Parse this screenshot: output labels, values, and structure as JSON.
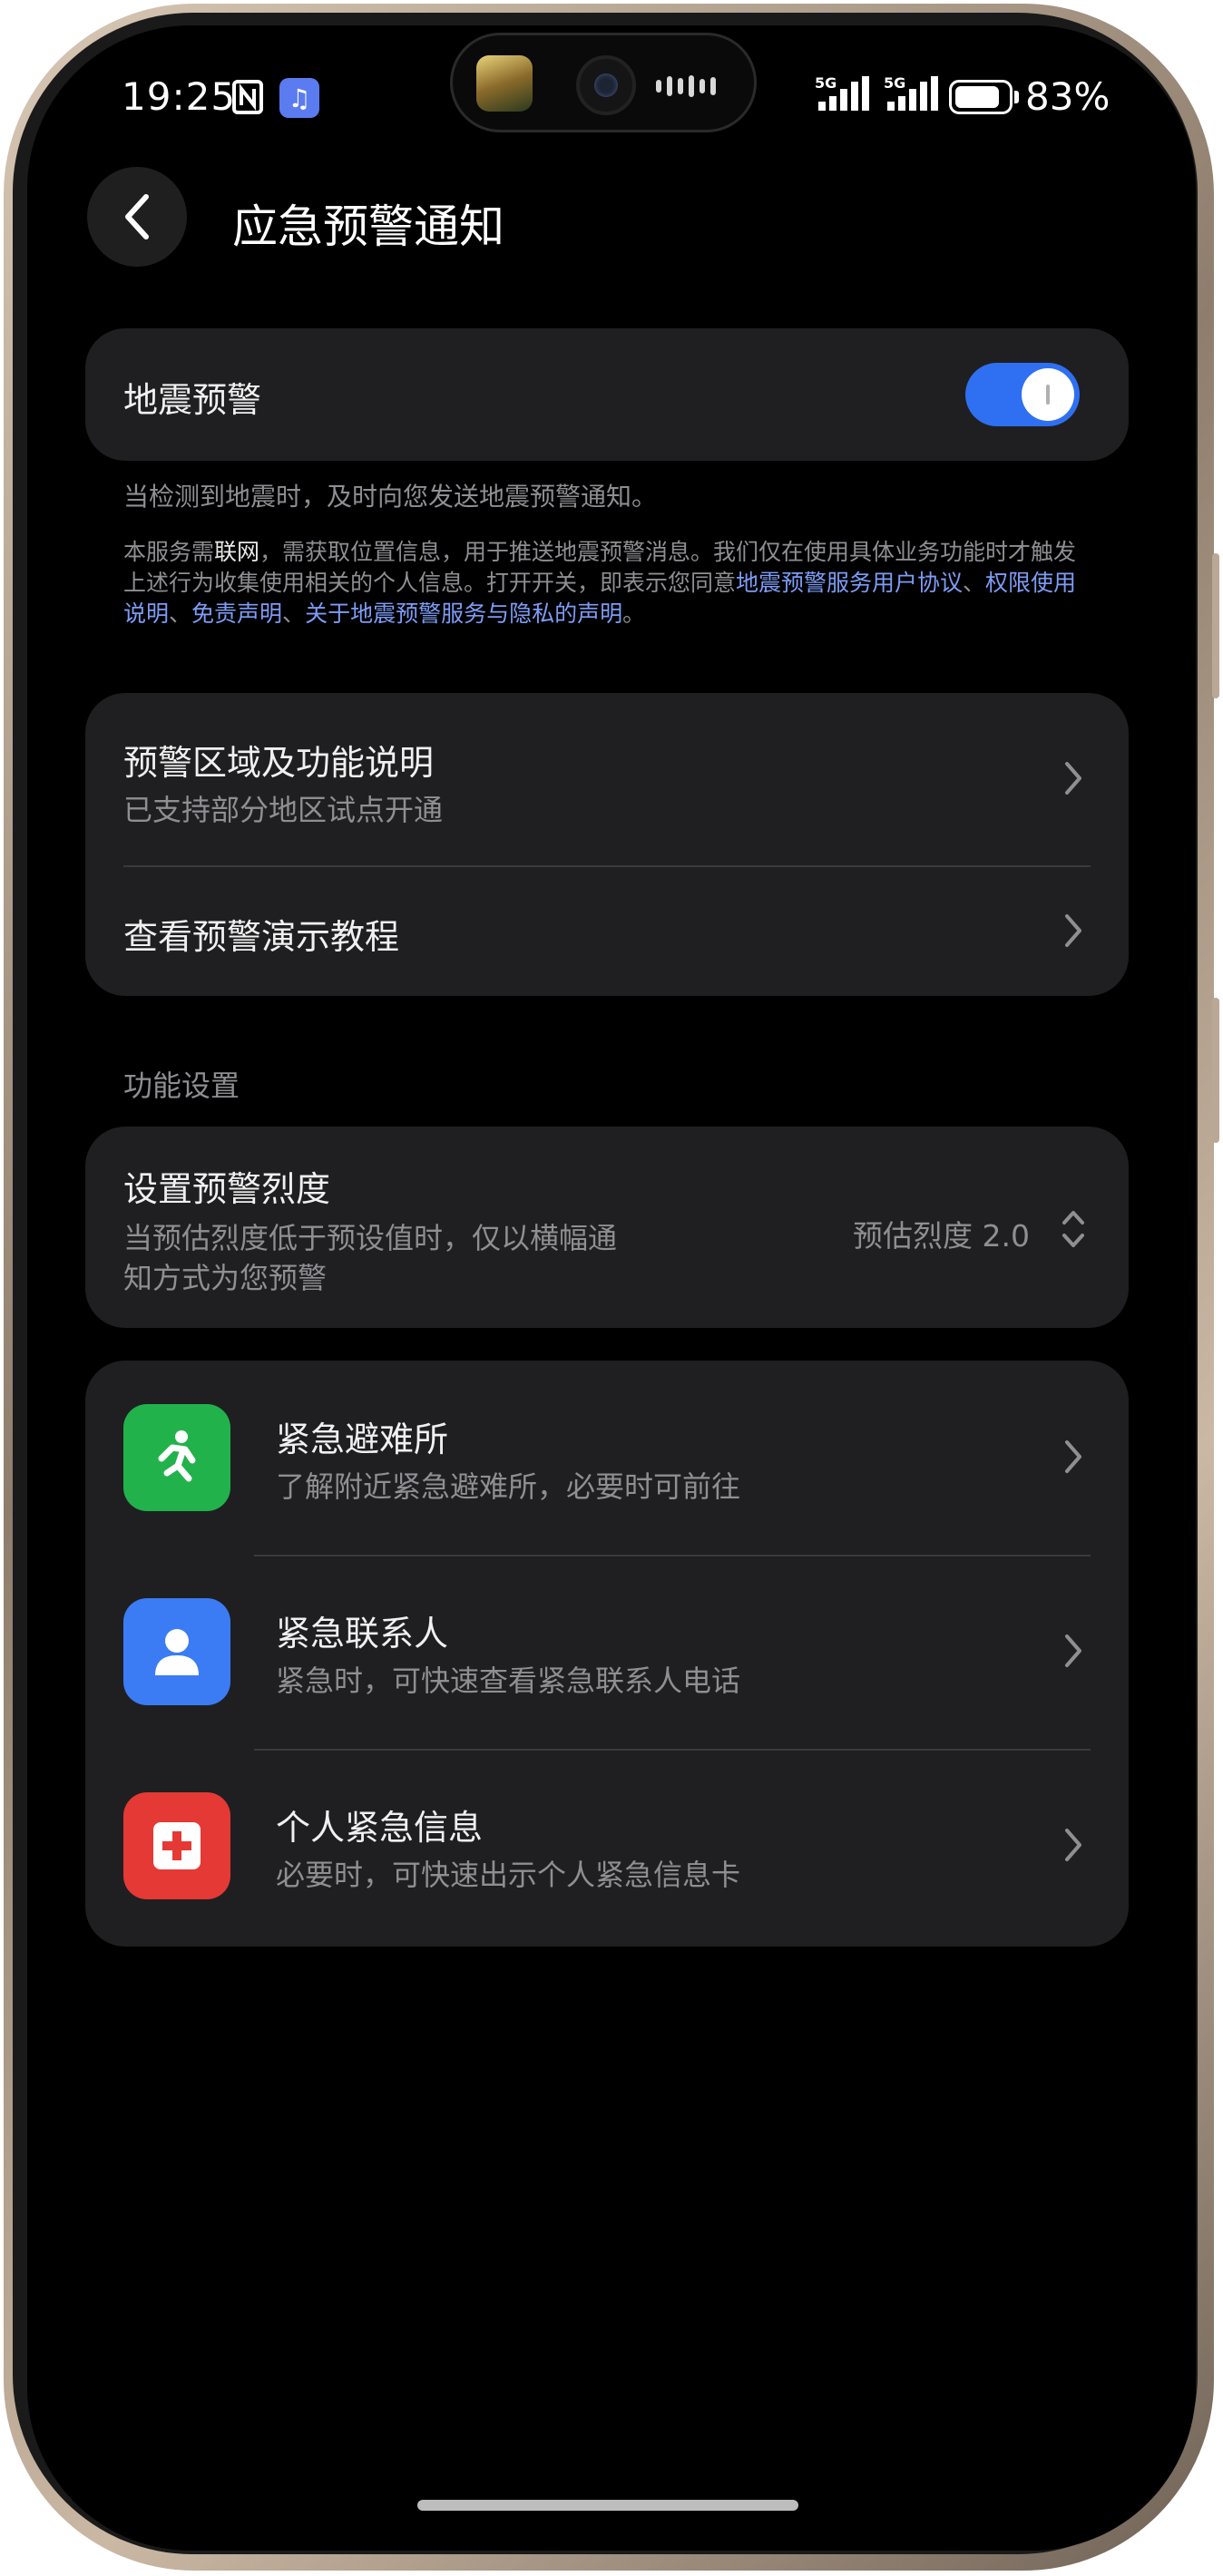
{
  "status_bar": {
    "time": "19:25",
    "nfc_icon": "nfc-icon",
    "app_badge_icon": "music-note-icon",
    "signal_1_label": "5G",
    "signal_2_label": "5G",
    "battery_percent": "83%",
    "battery_level": 0.83
  },
  "header": {
    "back_icon": "chevron-left-icon",
    "title": "应急预警通知"
  },
  "earthquake_toggle": {
    "label": "地震预警",
    "enabled": true,
    "accent_color": "#2f6ff2"
  },
  "description": "当检测到地震时，及时向您发送地震预警通知。",
  "legal": {
    "part1": "本服务需",
    "network": "联网",
    "part2": "，需获取位置信息，用于推送地震预警消息。我们仅在使用具体业务功能时才触发上述行为收集使用相关的个人信息。打开开关，即表示您同意",
    "link1": "地震预警服务用户协议",
    "sep1": "、",
    "link2": "权限使用说明",
    "sep2": "、",
    "link3": "免责声明",
    "sep3": "、",
    "link4": "关于地震预警服务与隐私的声明",
    "end": "。",
    "link_color": "#7d9cf5"
  },
  "info_card": {
    "items": [
      {
        "title": "预警区域及功能说明",
        "subtitle": "已支持部分地区试点开通"
      },
      {
        "title": "查看预警演示教程"
      }
    ]
  },
  "section_label": "功能设置",
  "intensity": {
    "title": "设置预警烈度",
    "subtitle_line1": "当预估烈度低于预设值时，仅以横幅通",
    "subtitle_line2": "知方式为您预警",
    "value": "预估烈度 2.0",
    "stepper_icon": "up-down-chevron-icon"
  },
  "emergency_card": {
    "items": [
      {
        "title": "紧急避难所",
        "subtitle": "了解附近紧急避难所，必要时可前往",
        "icon": "running-person-icon",
        "icon_color": "#22b24c"
      },
      {
        "title": "紧急联系人",
        "subtitle": "紧急时，可快速查看紧急联系人电话",
        "icon": "person-icon",
        "icon_color": "#3b7cf5"
      },
      {
        "title": "个人紧急信息",
        "subtitle": "必要时，可快速出示个人紧急信息卡",
        "icon": "medical-cross-icon",
        "icon_color": "#e53935"
      }
    ]
  }
}
